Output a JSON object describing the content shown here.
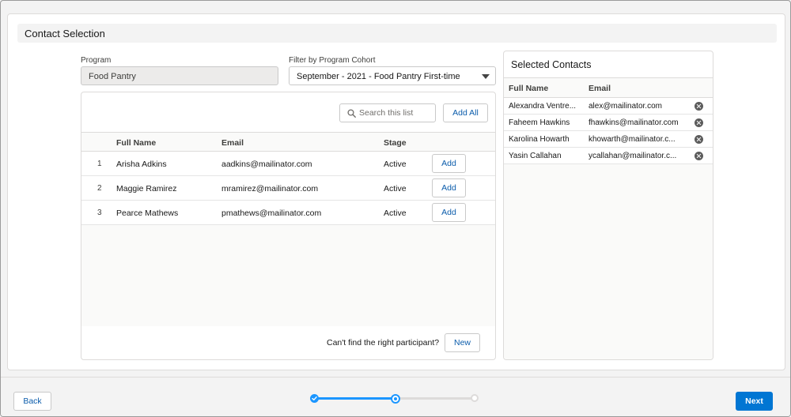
{
  "card": {
    "title": "Contact Selection"
  },
  "program": {
    "label": "Program",
    "value": "Food Pantry"
  },
  "cohort": {
    "label": "Filter by Program Cohort",
    "value": "September - 2021 - Food Pantry First-time"
  },
  "list": {
    "search_placeholder": "Search this list",
    "add_all_label": "Add All",
    "columns": {
      "name": "Full Name",
      "email": "Email",
      "stage": "Stage"
    },
    "rows": [
      {
        "num": "1",
        "name": "Arisha Adkins",
        "email": "aadkins@mailinator.com",
        "stage": "Active",
        "action": "Add"
      },
      {
        "num": "2",
        "name": "Maggie Ramirez",
        "email": "mramirez@mailinator.com",
        "stage": "Active",
        "action": "Add"
      },
      {
        "num": "3",
        "name": "Pearce Mathews",
        "email": "pmathews@mailinator.com",
        "stage": "Active",
        "action": "Add"
      }
    ],
    "footer_text": "Can't find the right participant?",
    "new_label": "New"
  },
  "selected": {
    "title": "Selected Contacts",
    "columns": {
      "name": "Full Name",
      "email": "Email"
    },
    "rows": [
      {
        "name": "Alexandra Ventre...",
        "email": "alex@mailinator.com"
      },
      {
        "name": "Faheem Hawkins",
        "email": "fhawkins@mailinator.com"
      },
      {
        "name": "Karolina Howarth",
        "email": "khowarth@mailinator.c..."
      },
      {
        "name": "Yasin Callahan",
        "email": "ycallahan@mailinator.c..."
      }
    ]
  },
  "nav": {
    "back_label": "Back",
    "next_label": "Next",
    "progress": {
      "total_steps": 3,
      "current_step": 2
    }
  },
  "colors": {
    "brand": "#0176d3",
    "link": "#0b5cab",
    "progress_done": "#1b96ff",
    "progress_todo": "#dddbda"
  },
  "icons": {
    "search": "search-icon",
    "remove": "close-circle-icon",
    "select_caret": "chevron-down-icon",
    "step_complete": "check-icon"
  }
}
